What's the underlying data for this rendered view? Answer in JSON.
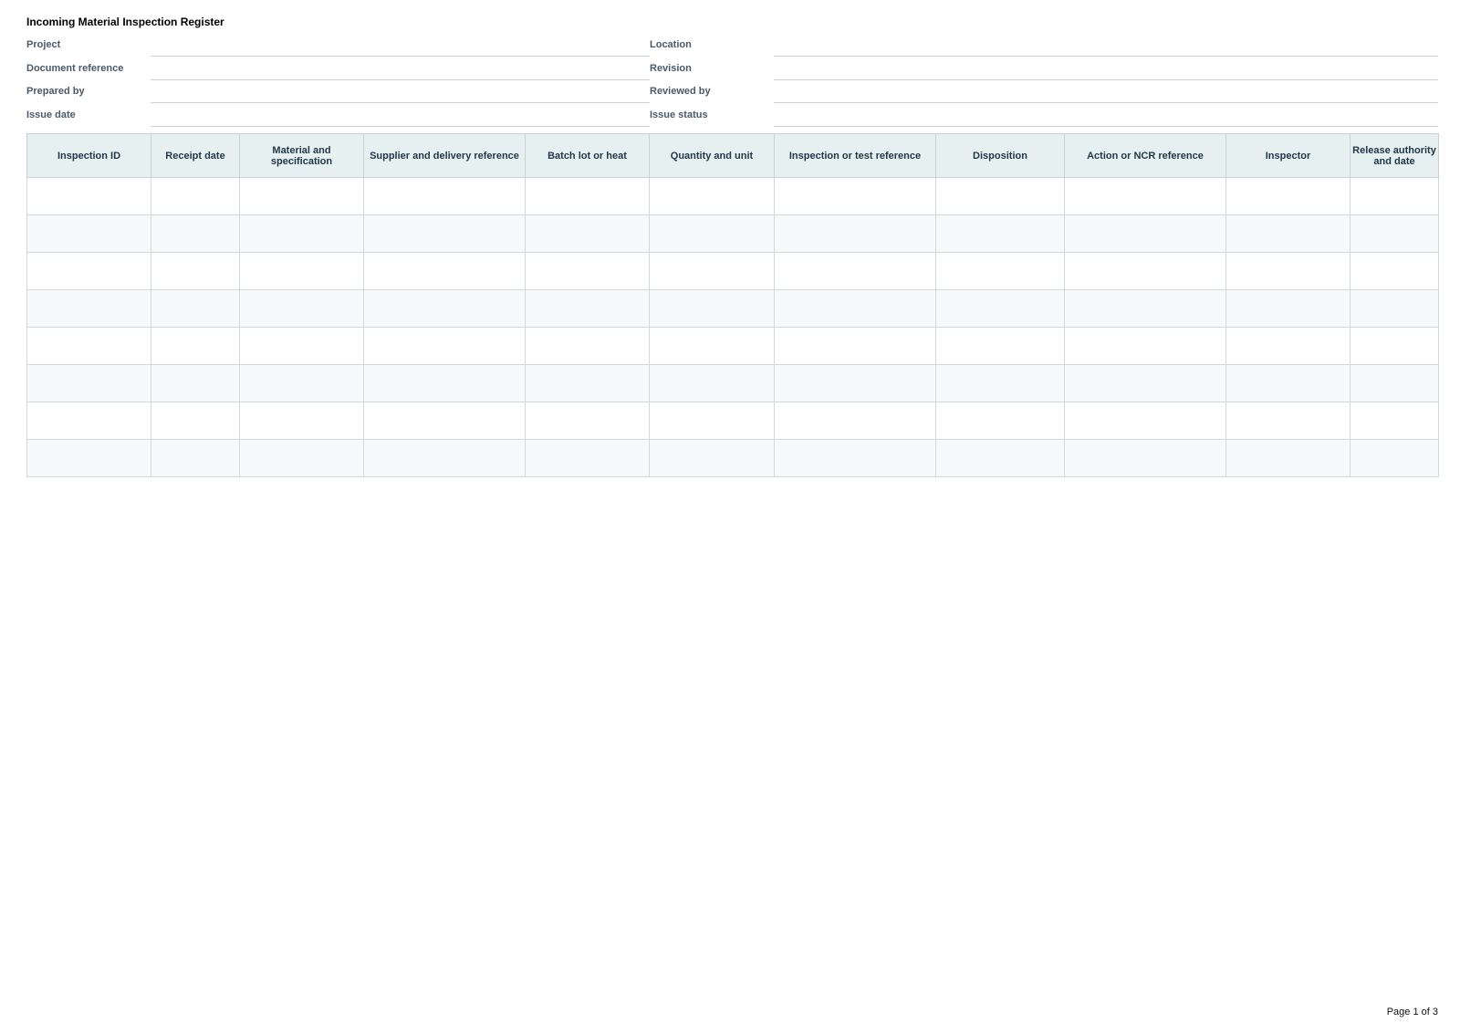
{
  "document": {
    "title": "Incoming Material Inspection Register",
    "page_label": "Page 1 of 3"
  },
  "meta_fields": [
    {
      "left_label": "Project",
      "left_value": "",
      "right_label": "Location",
      "right_value": ""
    },
    {
      "left_label": "Document reference",
      "left_value": "",
      "right_label": "Revision",
      "right_value": ""
    },
    {
      "left_label": "Prepared by",
      "left_value": "",
      "right_label": "Reviewed by",
      "right_value": ""
    },
    {
      "left_label": "Issue date",
      "left_value": "",
      "right_label": "Issue status",
      "right_value": ""
    }
  ],
  "table": {
    "columns": [
      "Inspection ID",
      "Receipt date",
      "Material and specification",
      "Supplier and delivery reference",
      "Batch lot or heat",
      "Quantity and unit",
      "Inspection or test reference",
      "Disposition",
      "Action or NCR reference",
      "Inspector",
      "Release authority and date"
    ],
    "rows": [
      [
        "",
        "",
        "",
        "",
        "",
        "",
        "",
        "",
        "",
        "",
        ""
      ],
      [
        "",
        "",
        "",
        "",
        "",
        "",
        "",
        "",
        "",
        "",
        ""
      ],
      [
        "",
        "",
        "",
        "",
        "",
        "",
        "",
        "",
        "",
        "",
        ""
      ],
      [
        "",
        "",
        "",
        "",
        "",
        "",
        "",
        "",
        "",
        "",
        ""
      ],
      [
        "",
        "",
        "",
        "",
        "",
        "",
        "",
        "",
        "",
        "",
        ""
      ],
      [
        "",
        "",
        "",
        "",
        "",
        "",
        "",
        "",
        "",
        "",
        ""
      ],
      [
        "",
        "",
        "",
        "",
        "",
        "",
        "",
        "",
        "",
        "",
        ""
      ],
      [
        "",
        "",
        "",
        "",
        "",
        "",
        "",
        "",
        "",
        "",
        ""
      ]
    ]
  }
}
